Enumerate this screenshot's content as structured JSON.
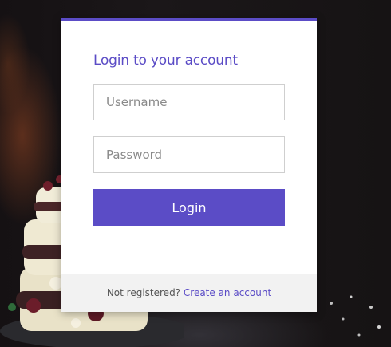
{
  "login_form": {
    "title": "Login to your account",
    "username_placeholder": "Username",
    "username_value": "",
    "password_placeholder": "Password",
    "password_value": "",
    "login_button_label": "Login"
  },
  "footer": {
    "prompt_text": "Not registered?",
    "create_account_link": "Create an account"
  },
  "colors": {
    "accent": "#5b4cc6",
    "footer_bg": "#f2f2f2",
    "card_bg": "#ffffff"
  }
}
